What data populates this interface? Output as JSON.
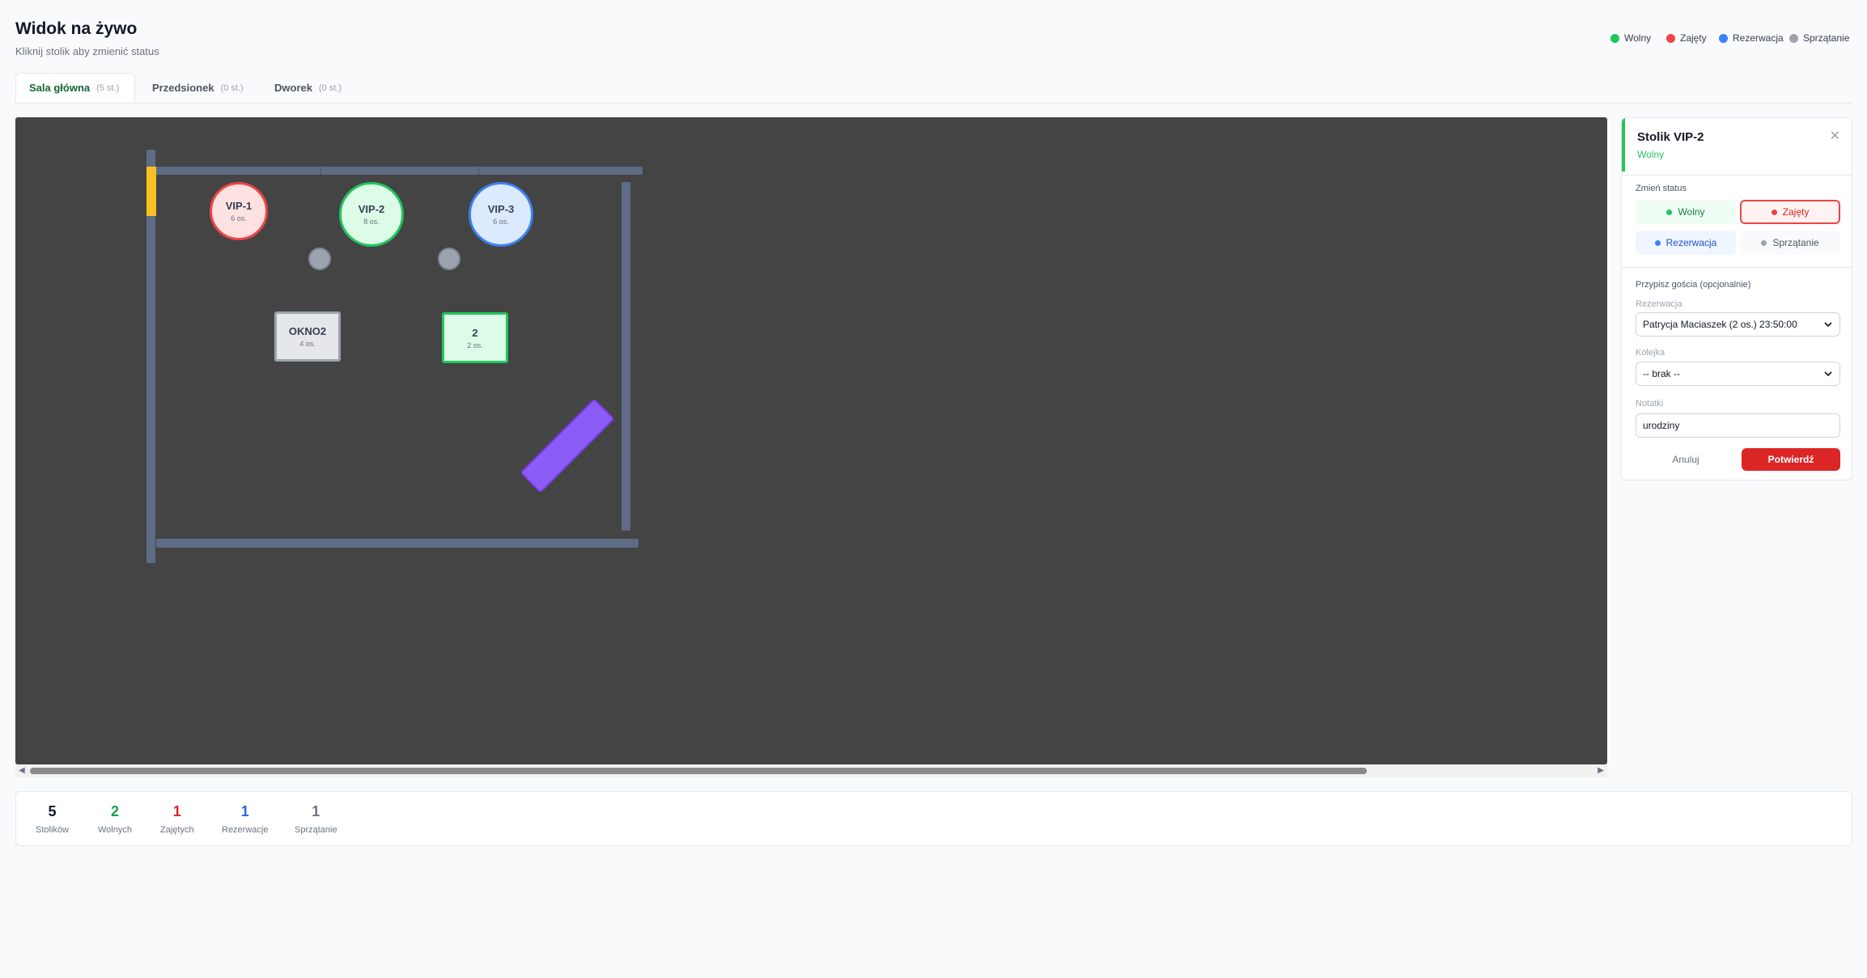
{
  "header": {
    "title": "Widok na żywo",
    "subtitle": "Kliknij stolik aby zmienić status"
  },
  "legend": [
    {
      "label": "Wolny",
      "color": "#22c55e"
    },
    {
      "label": "Zajęty",
      "color": "#ef4444"
    },
    {
      "label": "Rezerwacja",
      "color": "#3b82f6"
    },
    {
      "label": "Sprzątanie",
      "color": "#9ca3af"
    }
  ],
  "tabs": [
    {
      "label": "Sala główna",
      "count": "(5 st.)",
      "active": true
    },
    {
      "label": "Przedsionek",
      "count": "(0 st.)"
    },
    {
      "label": "Dworek",
      "count": "(0 st.)"
    }
  ],
  "tables": [
    {
      "name": "VIP-1",
      "seats": "6 os.",
      "status": "Zajęty"
    },
    {
      "name": "VIP-2",
      "seats": "8 os.",
      "status": "Wolny"
    },
    {
      "name": "VIP-3",
      "seats": "6 os.",
      "status": "Rezerwacja"
    },
    {
      "name": "OKNO2",
      "seats": "4 os.",
      "status": "Sprzątanie"
    },
    {
      "name": "2",
      "seats": "2 os.",
      "status": "Wolny"
    }
  ],
  "stats": [
    {
      "value": "5",
      "label": "Stolików",
      "color": "#111827"
    },
    {
      "value": "2",
      "label": "Wolnych",
      "color": "#16a34a"
    },
    {
      "value": "1",
      "label": "Zajętych",
      "color": "#dc2626"
    },
    {
      "value": "1",
      "label": "Rezerwacje",
      "color": "#2563eb"
    },
    {
      "value": "1",
      "label": "Sprzątanie",
      "color": "#6b7280"
    }
  ],
  "panel": {
    "title": "Stolik VIP-2",
    "status": "Wolny",
    "change_status_label": "Zmień status",
    "status_buttons": [
      "Wolny",
      "Zajęty",
      "Rezerwacja",
      "Sprzątanie"
    ],
    "assign_label": "Przypisz gościa (opcjonalnie)",
    "reservation_label": "Rezerwacja",
    "reservation_value": "Patrycja Maciaszek (2 os.) 23:50:00",
    "queue_label": "Kolejka",
    "queue_value": "-- brak --",
    "notes_label": "Notatki",
    "notes_value": "urodziny",
    "cancel_label": "Anuluj",
    "confirm_label": "Potwierdź"
  }
}
